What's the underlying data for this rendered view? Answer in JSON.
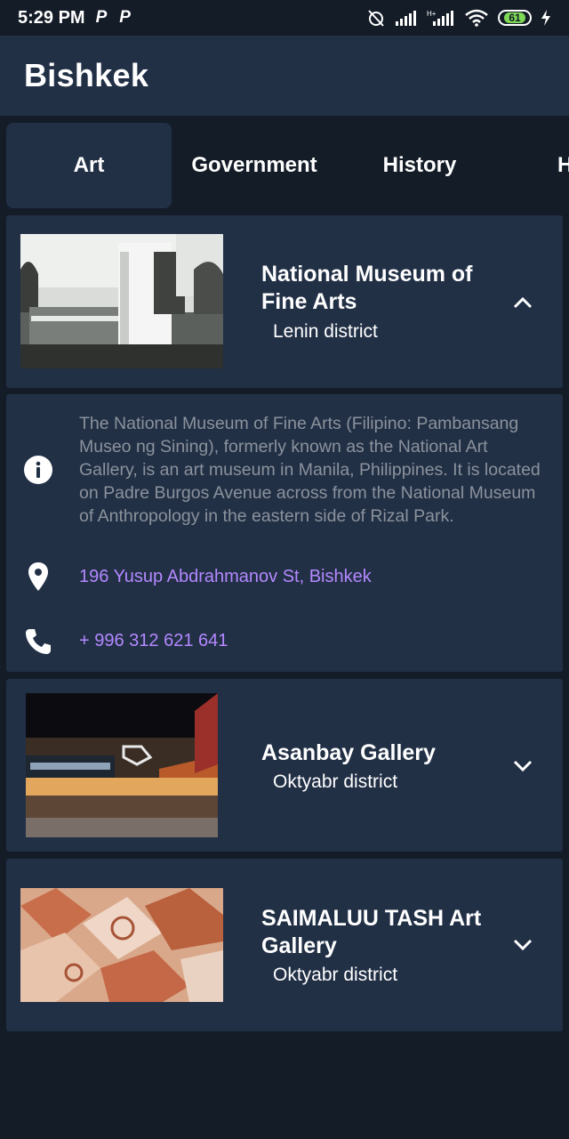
{
  "status_bar": {
    "time": "5:29 PM",
    "notif_1": "P",
    "notif_2": "P",
    "battery": "61"
  },
  "app_bar": {
    "title": "Bishkek"
  },
  "tabs": [
    {
      "label": "Art",
      "active": true
    },
    {
      "label": "Government",
      "active": false
    },
    {
      "label": "History",
      "active": false
    },
    {
      "label": "H",
      "active": false
    }
  ],
  "places": [
    {
      "name": "National Museum of Fine Arts",
      "district": "Lenin district",
      "expanded": true,
      "description": "The National Museum of Fine Arts (Filipino: Pambansang Museo ng Sining), formerly known as the National Art Gallery, is an art museum in Manila, Philippines. It is located on Padre Burgos Avenue across from the National Museum of Anthropology in the eastern side of Rizal Park.",
      "address": "196 Yusup Abdrahmanov St, Bishkek",
      "phone": "+ 996 312 621 641"
    },
    {
      "name": "Asanbay Gallery",
      "district": "Oktyabr district",
      "expanded": false
    },
    {
      "name": "SAIMALUU TASH Art Gallery",
      "district": "Oktyabr district",
      "expanded": false
    }
  ],
  "colors": {
    "background": "#141c27",
    "surface": "#223046",
    "link": "#b388ff",
    "muted_text": "#8b929c"
  }
}
